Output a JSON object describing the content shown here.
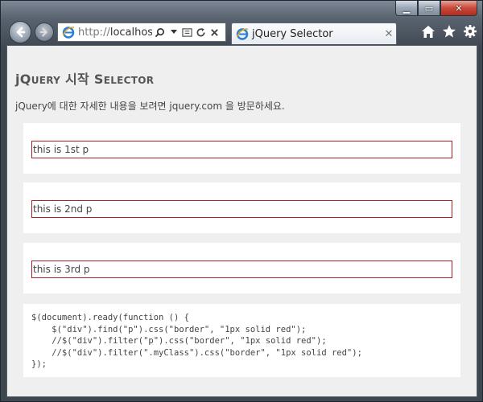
{
  "browser": {
    "address": {
      "scheme": "http://",
      "host": "localhost:"
    },
    "tab": {
      "title": "jQuery Selector",
      "close_glyph": "✕"
    },
    "caption": {
      "minimize": "▁",
      "maximize": "▭",
      "close": "✕"
    }
  },
  "page": {
    "title_prefix": "j",
    "title_q": "Q",
    "title_uery": "UERY",
    "title_korean": " 시작 ",
    "title_s": "S",
    "title_elector": "ELECTOR",
    "description": "jQuery에 대한 자세한 내용을 보려면 jquery.com 을 방문하세요.",
    "paragraphs": [
      "this is 1st p",
      "this is 2nd p",
      "this is 3rd p"
    ],
    "code_lines": [
      "$(document).ready(function () {",
      "    $(\"div\").find(\"p\").css(\"border\", \"1px solid red\");",
      "    //$(\"div\").filter(\"p\").css(\"border\", \"1px solid red\");",
      "    //$(\"div\").filter(\".myClass\").css(\"border\", \"1px solid red\");",
      "});"
    ]
  },
  "colors": {
    "paragraph_border": "#b11d24",
    "page_background": "#efefef"
  },
  "icons": [
    "back-icon",
    "forward-icon",
    "ie-logo-icon",
    "search-icon",
    "dropdown-icon",
    "compatibility-icon",
    "refresh-icon",
    "stop-icon",
    "home-icon",
    "favorites-star-icon",
    "tools-gear-icon"
  ]
}
